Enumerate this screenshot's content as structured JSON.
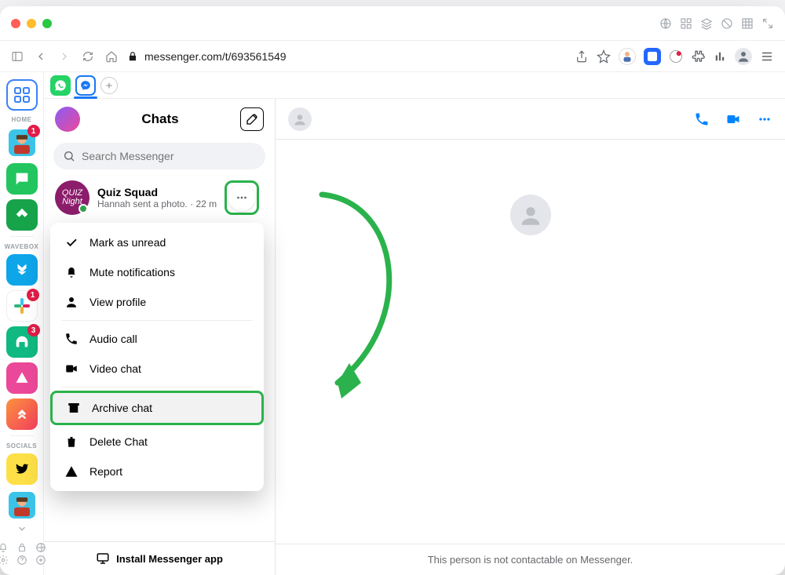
{
  "browser": {
    "url": "messenger.com/t/693561549"
  },
  "dock": {
    "home_label": "HOME",
    "wavebox_label": "WAVEBOX",
    "socials_label": "SOCIALS",
    "badges": {
      "user": "1",
      "slack": "1",
      "headphones": "3"
    }
  },
  "messenger": {
    "title": "Chats",
    "search_placeholder": "Search Messenger",
    "conversation": {
      "name": "Quiz Squad",
      "preview": "Hannah sent a photo.",
      "time": "22 m",
      "avatar_text": "QUIZ Night"
    },
    "menu": {
      "mark_unread": "Mark as unread",
      "mute": "Mute notifications",
      "profile": "View profile",
      "audio": "Audio call",
      "video": "Video chat",
      "archive": "Archive chat",
      "delete": "Delete Chat",
      "report": "Report"
    },
    "install": "Install Messenger app",
    "not_contactable": "This person is not contactable on Messenger."
  }
}
